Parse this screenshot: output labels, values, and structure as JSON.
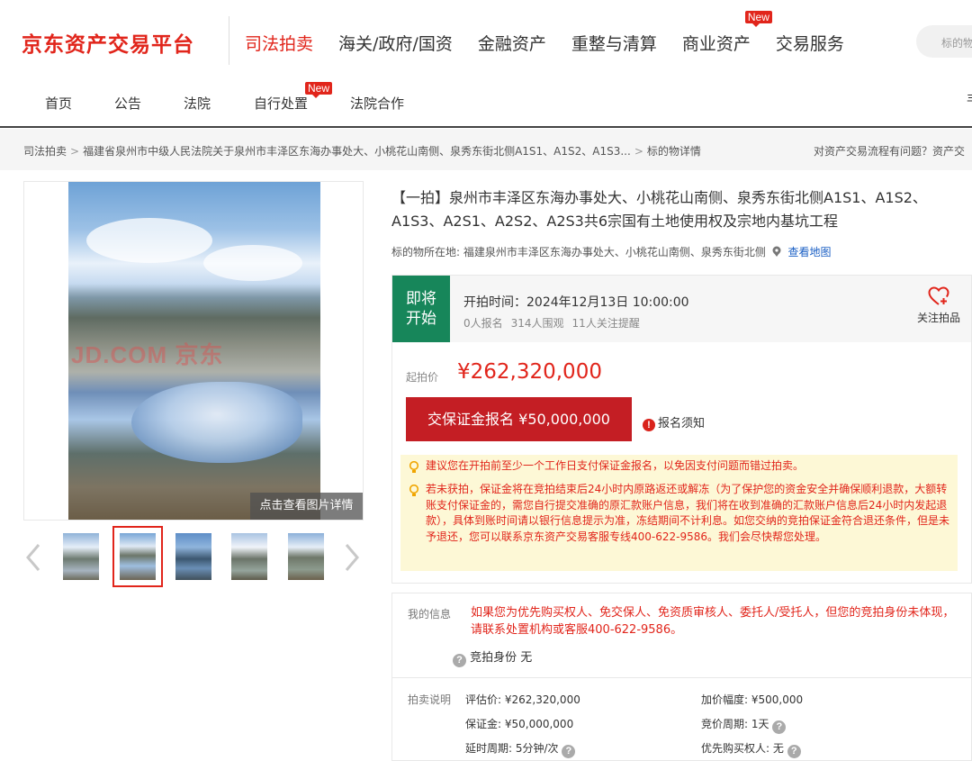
{
  "header": {
    "logo": "京东资产交易平台",
    "nav": [
      {
        "label": "司法拍卖",
        "active": true
      },
      {
        "label": "海关/政府/国资"
      },
      {
        "label": "金融资产"
      },
      {
        "label": "重整与清算"
      },
      {
        "label": "商业资产",
        "badge": "New"
      },
      {
        "label": "交易服务"
      }
    ],
    "search_placeholder": "标的物"
  },
  "subnav": {
    "items": [
      "首页",
      "公告",
      "法院",
      "自行处置",
      "法院合作"
    ],
    "badge": "New",
    "edge_text": "丰"
  },
  "breadcrumb": {
    "items": [
      "司法拍卖",
      "福建省泉州市中级人民法院关于泉州市丰泽区东海办事处大、小桃花山南侧、泉秀东街北侧A1S1、A1S2、A1S3...",
      "标的物详情"
    ],
    "help": "对资产交易流程有问题？资产交"
  },
  "gallery": {
    "watermark": "JD.COM 京东",
    "view_detail": "点击查看图片详情"
  },
  "item": {
    "title": "【一拍】泉州市丰泽区东海办事处大、小桃花山南侧、泉秀东街北侧A1S1、A1S2、A1S3、A2S1、A2S2、A2S3共6宗国有土地使用权及宗地内基坑工程",
    "location_label": "标的物所在地:",
    "location": "福建泉州市丰泽区东海办事处大、小桃花山南侧、泉秀东街北侧",
    "map_link": "查看地图"
  },
  "auction": {
    "status": "即将开始",
    "start_time": "开拍时间：2024年12月13日 10:00:00",
    "registered": "0人报名",
    "views": "314人围观",
    "reminders": "11人关注提醒",
    "follow_label": "关注拍品",
    "price_label": "起拍价",
    "price": "¥262,320,000",
    "deposit_button": "交保证金报名 ¥50,000,000",
    "notice_label": "报名须知",
    "tips": [
      "建议您在开拍前至少一个工作日支付保证金报名，以免因支付问题而错过拍卖。",
      "若未获拍，保证金将在竞拍结束后24小时内原路返还或解冻（为了保护您的资金安全并确保顺利退款，大额转账支付保证金的，需您自行提交准确的原汇款账户信息，我们将在收到准确的汇款账户信息后24小时内发起退款），具体到账时间请以银行信息提示为准，冻结期间不计利息。如您交纳的竞拍保证金符合退还条件，但是未予退还，您可以联系京东资产交易客服专线400-622-9586。我们会尽快帮您处理。"
    ]
  },
  "my_info": {
    "label": "我的信息",
    "text": "如果您为优先购买权人、免交保人、免资质审核人、委托人/受托人，但您的竞拍身份未体现，请联系处置机构或客服400-622-9586。",
    "identity_label": "竞拍身份",
    "identity_value": "无"
  },
  "auction_desc": {
    "label": "拍卖说明",
    "appraisal": "评估价: ¥262,320,000",
    "increment": "加价幅度: ¥500,000",
    "deposit": "保证金: ¥50,000,000",
    "cycle": "竞价周期: 1天",
    "delay": "延时周期: 5分钟/次",
    "priority": "优先购买权人: 无"
  },
  "colors": {
    "brand_red": "#e1251b",
    "status_green": "#17865a",
    "button_red": "#c41e24",
    "tip_bg": "#fdf8d6",
    "link_blue": "#1a5fc4"
  }
}
